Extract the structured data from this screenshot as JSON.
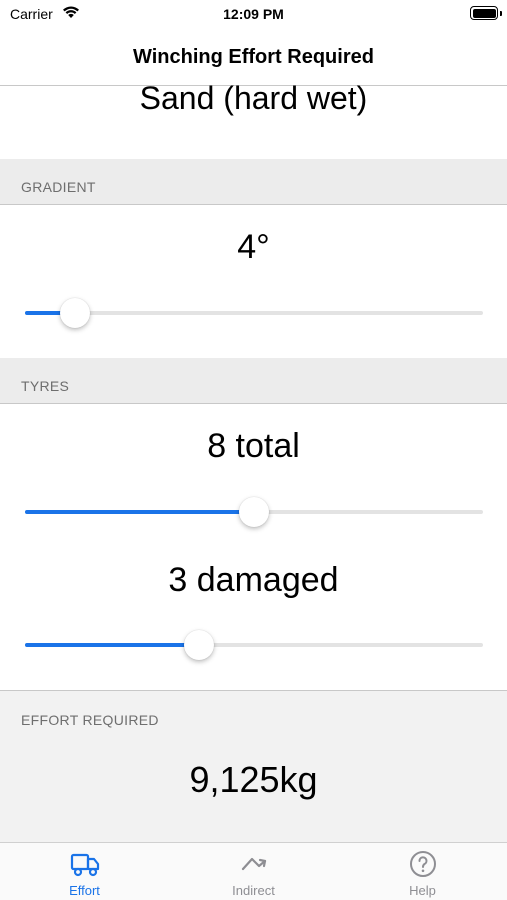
{
  "status_bar": {
    "carrier": "Carrier",
    "time": "12:09 PM"
  },
  "nav": {
    "title": "Winching Effort Required"
  },
  "surface": {
    "value": "Sand (hard wet)"
  },
  "gradient": {
    "header": "GRADIENT",
    "value_label": "4°",
    "slider_fraction": 0.11
  },
  "tyres": {
    "header": "TYRES",
    "total_label": "8 total",
    "total_fraction": 0.5,
    "damaged_label": "3 damaged",
    "damaged_fraction": 0.38
  },
  "effort": {
    "header": "EFFORT REQUIRED",
    "value": "9,125kg"
  },
  "tabs": [
    {
      "label": "Effort",
      "icon": "truck-icon",
      "active": true
    },
    {
      "label": "Indirect",
      "icon": "indirect-arrow-icon",
      "active": false
    },
    {
      "label": "Help",
      "icon": "help-icon",
      "active": false
    }
  ],
  "colors": {
    "accent": "#1a73e8",
    "inactive": "#8e8e93",
    "header_bg": "#ececec"
  }
}
